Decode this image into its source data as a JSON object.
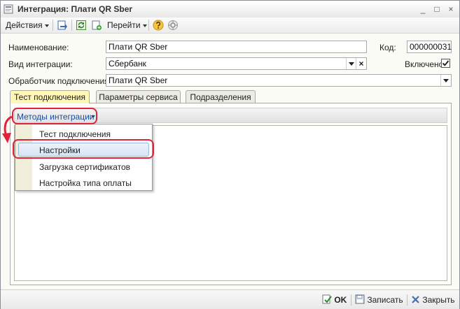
{
  "window": {
    "title": "Интеграция: Плати QR Sber",
    "controls": [
      "_",
      "□",
      "×"
    ]
  },
  "toolbar": {
    "actions_label": "Действия",
    "goto_label": "Перейти"
  },
  "form": {
    "name_label": "Наименование:",
    "name_value": "Плати QR Sber",
    "code_label": "Код:",
    "code_value": "000000031",
    "type_label": "Вид интеграции:",
    "type_value": "Сбербанк",
    "enabled_label": "Включено",
    "enabled": true,
    "handler_label": "Обработчик подключения:",
    "handler_value": "Плати QR Sber"
  },
  "tabs": [
    {
      "label": "Тест подключения",
      "active": true
    },
    {
      "label": "Параметры сервиса",
      "active": false
    },
    {
      "label": "Подразделения",
      "active": false
    }
  ],
  "menu": {
    "button_label": "Методы интеграции",
    "items": [
      "Тест подключения",
      "Настройки",
      "Загрузка сертификатов",
      "Настройка типа оплаты"
    ],
    "highlighted_index": 1
  },
  "footer": {
    "ok_label": "OK",
    "save_label": "Записать",
    "close_label": "Закрыть"
  },
  "colors": {
    "highlight_ring": "#e0233b",
    "active_tab": "#fff7b6",
    "link_blue": "#1b4c9e"
  }
}
